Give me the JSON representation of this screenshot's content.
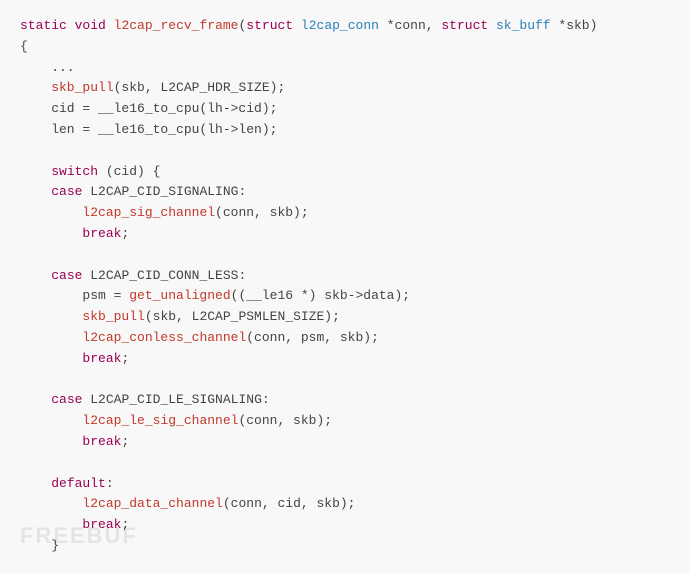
{
  "code": {
    "lines": [
      {
        "id": 1,
        "tokens": [
          {
            "text": "static",
            "cls": "kw"
          },
          {
            "text": " ",
            "cls": "plain"
          },
          {
            "text": "void",
            "cls": "kw"
          },
          {
            "text": " ",
            "cls": "plain"
          },
          {
            "text": "l2cap_recv_frame",
            "cls": "fn"
          },
          {
            "text": "(",
            "cls": "plain"
          },
          {
            "text": "struct",
            "cls": "kw"
          },
          {
            "text": " ",
            "cls": "plain"
          },
          {
            "text": "l2cap_conn",
            "cls": "type"
          },
          {
            "text": " *conn, ",
            "cls": "plain"
          },
          {
            "text": "struct",
            "cls": "kw"
          },
          {
            "text": " ",
            "cls": "plain"
          },
          {
            "text": "sk_buff",
            "cls": "type"
          },
          {
            "text": " *skb)",
            "cls": "plain"
          }
        ]
      },
      {
        "id": 2,
        "tokens": [
          {
            "text": "{",
            "cls": "plain"
          }
        ]
      },
      {
        "id": 3,
        "tokens": [
          {
            "text": "    ...",
            "cls": "plain"
          }
        ]
      },
      {
        "id": 4,
        "tokens": [
          {
            "text": "    skb_pull",
            "cls": "fn"
          },
          {
            "text": "(skb, L2CAP_HDR_SIZE);",
            "cls": "plain"
          }
        ]
      },
      {
        "id": 5,
        "tokens": [
          {
            "text": "    cid = __le16_to_cpu(lh->cid);",
            "cls": "plain"
          }
        ]
      },
      {
        "id": 6,
        "tokens": [
          {
            "text": "    len = __le16_to_cpu(lh->len);",
            "cls": "plain"
          }
        ]
      },
      {
        "id": 7,
        "tokens": [
          {
            "text": "",
            "cls": "plain"
          }
        ]
      },
      {
        "id": 8,
        "tokens": [
          {
            "text": "    ",
            "cls": "plain"
          },
          {
            "text": "switch",
            "cls": "kw"
          },
          {
            "text": " (cid) {",
            "cls": "plain"
          }
        ]
      },
      {
        "id": 9,
        "tokens": [
          {
            "text": "    ",
            "cls": "plain"
          },
          {
            "text": "case",
            "cls": "kw"
          },
          {
            "text": " L2CAP_CID_SIGNALING:",
            "cls": "plain"
          }
        ]
      },
      {
        "id": 10,
        "tokens": [
          {
            "text": "        ",
            "cls": "plain"
          },
          {
            "text": "l2cap_sig_channel",
            "cls": "fn"
          },
          {
            "text": "(conn, skb);",
            "cls": "plain"
          }
        ]
      },
      {
        "id": 11,
        "tokens": [
          {
            "text": "        ",
            "cls": "plain"
          },
          {
            "text": "break",
            "cls": "kw"
          },
          {
            "text": ";",
            "cls": "plain"
          }
        ]
      },
      {
        "id": 12,
        "tokens": [
          {
            "text": "",
            "cls": "plain"
          }
        ]
      },
      {
        "id": 13,
        "tokens": [
          {
            "text": "    ",
            "cls": "plain"
          },
          {
            "text": "case",
            "cls": "kw"
          },
          {
            "text": " L2CAP_CID_CONN_LESS:",
            "cls": "plain"
          }
        ]
      },
      {
        "id": 14,
        "tokens": [
          {
            "text": "        psm = ",
            "cls": "plain"
          },
          {
            "text": "get_unaligned",
            "cls": "fn"
          },
          {
            "text": "((__le16 *) skb->data);",
            "cls": "plain"
          }
        ]
      },
      {
        "id": 15,
        "tokens": [
          {
            "text": "        ",
            "cls": "plain"
          },
          {
            "text": "skb_pull",
            "cls": "fn"
          },
          {
            "text": "(skb, L2CAP_PSMLEN_SIZE);",
            "cls": "plain"
          }
        ]
      },
      {
        "id": 16,
        "tokens": [
          {
            "text": "        ",
            "cls": "plain"
          },
          {
            "text": "l2cap_conless_channel",
            "cls": "fn"
          },
          {
            "text": "(conn, psm, skb);",
            "cls": "plain"
          }
        ]
      },
      {
        "id": 17,
        "tokens": [
          {
            "text": "        ",
            "cls": "plain"
          },
          {
            "text": "break",
            "cls": "kw"
          },
          {
            "text": ";",
            "cls": "plain"
          }
        ]
      },
      {
        "id": 18,
        "tokens": [
          {
            "text": "",
            "cls": "plain"
          }
        ]
      },
      {
        "id": 19,
        "tokens": [
          {
            "text": "    ",
            "cls": "plain"
          },
          {
            "text": "case",
            "cls": "kw"
          },
          {
            "text": " L2CAP_CID_LE_SIGNALING:",
            "cls": "plain"
          }
        ]
      },
      {
        "id": 20,
        "tokens": [
          {
            "text": "        ",
            "cls": "plain"
          },
          {
            "text": "l2cap_le_sig_channel",
            "cls": "fn"
          },
          {
            "text": "(conn, skb);",
            "cls": "plain"
          }
        ]
      },
      {
        "id": 21,
        "tokens": [
          {
            "text": "        ",
            "cls": "plain"
          },
          {
            "text": "break",
            "cls": "kw"
          },
          {
            "text": ";",
            "cls": "plain"
          }
        ]
      },
      {
        "id": 22,
        "tokens": [
          {
            "text": "",
            "cls": "plain"
          }
        ]
      },
      {
        "id": 23,
        "tokens": [
          {
            "text": "    ",
            "cls": "plain"
          },
          {
            "text": "default",
            "cls": "kw"
          },
          {
            "text": ":",
            "cls": "plain"
          }
        ]
      },
      {
        "id": 24,
        "tokens": [
          {
            "text": "        ",
            "cls": "plain"
          },
          {
            "text": "l2cap_data_channel",
            "cls": "fn"
          },
          {
            "text": "(conn, cid, skb);",
            "cls": "plain"
          }
        ]
      },
      {
        "id": 25,
        "tokens": [
          {
            "text": "        ",
            "cls": "plain"
          },
          {
            "text": "break",
            "cls": "kw"
          },
          {
            "text": ";",
            "cls": "plain"
          }
        ]
      },
      {
        "id": 26,
        "tokens": [
          {
            "text": "    }",
            "cls": "plain"
          }
        ]
      }
    ]
  },
  "watermark": "FREEBUF"
}
